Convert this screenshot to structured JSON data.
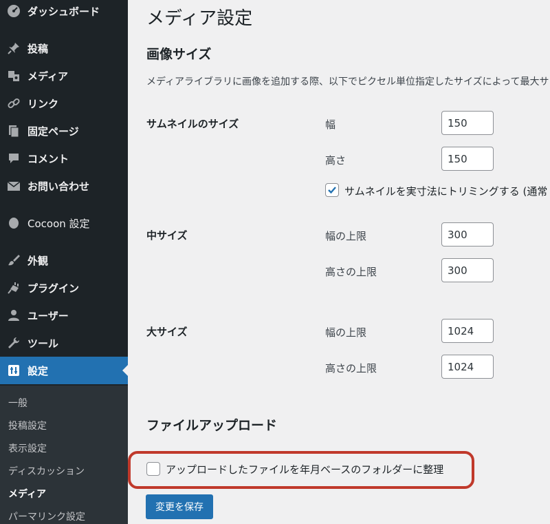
{
  "sidebar": {
    "items": [
      {
        "icon": "dashboard-icon",
        "label": "ダッシュボード"
      },
      {
        "icon": "pin-icon",
        "label": "投稿"
      },
      {
        "icon": "media-icon",
        "label": "メディア"
      },
      {
        "icon": "link-icon",
        "label": "リンク"
      },
      {
        "icon": "page-icon",
        "label": "固定ページ"
      },
      {
        "icon": "comment-icon",
        "label": "コメント"
      },
      {
        "icon": "mail-icon",
        "label": "お問い合わせ"
      },
      {
        "icon": "cocoon-icon",
        "label": "Cocoon 設定"
      },
      {
        "icon": "brush-icon",
        "label": "外観"
      },
      {
        "icon": "plugin-icon",
        "label": "プラグイン"
      },
      {
        "icon": "user-icon",
        "label": "ユーザー"
      },
      {
        "icon": "wrench-icon",
        "label": "ツール"
      },
      {
        "icon": "settings-icon",
        "label": "設定"
      }
    ],
    "submenu": [
      "一般",
      "投稿設定",
      "表示設定",
      "ディスカッション",
      "メディア",
      "パーマリンク設定"
    ],
    "current_item": "設定",
    "current_sub": "メディア",
    "colors": {
      "bg": "#1d2327",
      "current": "#2271b1",
      "submenu_bg": "#2c3338"
    }
  },
  "main": {
    "title": "メディア設定",
    "image_sizes": {
      "heading": "画像サイズ",
      "description": "メディアライブラリに画像を追加する際、以下でピクセル単位指定したサイズによって最大サ",
      "thumbnail": {
        "label": "サムネイルのサイズ",
        "width_label": "幅",
        "width_value": "150",
        "height_label": "高さ",
        "height_value": "150",
        "crop_label": "サムネイルを実寸法にトリミングする (通常",
        "crop_checked": true
      },
      "medium": {
        "label": "中サイズ",
        "width_label": "幅の上限",
        "width_value": "300",
        "height_label": "高さの上限",
        "height_value": "300"
      },
      "large": {
        "label": "大サイズ",
        "width_label": "幅の上限",
        "width_value": "1024",
        "height_label": "高さの上限",
        "height_value": "1024"
      }
    },
    "uploads": {
      "heading": "ファイルアップロード",
      "organize_label": "アップロードしたファイルを年月ベースのフォルダーに整理",
      "organize_checked": false
    },
    "save_label": "変更を保存",
    "colors": {
      "accent": "#2271b1",
      "highlight": "#c0392b"
    }
  }
}
